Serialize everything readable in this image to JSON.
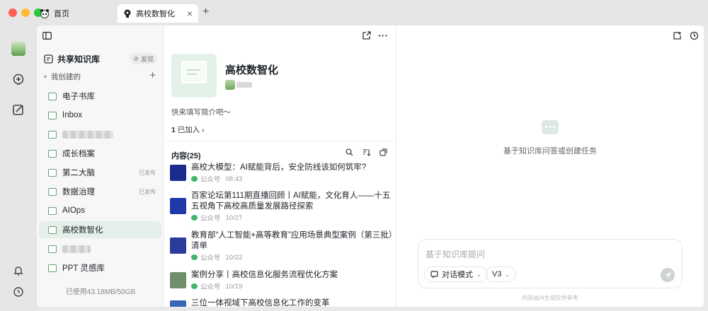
{
  "tabs": [
    {
      "label": "首页",
      "icon": "panda-icon"
    },
    {
      "label": "高校数智化",
      "icon": "bulb-icon",
      "active": true
    }
  ],
  "sidebar": {
    "shared_label": "共享知识库",
    "discover_label": "发现",
    "mine_label": "我创建的",
    "items": [
      {
        "label": "电子书库",
        "tag": ""
      },
      {
        "label": "Inbox",
        "tag": ""
      },
      {
        "label": "",
        "tag": "",
        "blurred": true
      },
      {
        "label": "成长档案",
        "tag": ""
      },
      {
        "label": "第二大脑",
        "tag": "已发布"
      },
      {
        "label": "数据治理",
        "tag": "已发布"
      },
      {
        "label": "AIOps",
        "tag": ""
      },
      {
        "label": "高校数智化",
        "tag": "",
        "active": true
      },
      {
        "label": "",
        "tag": "",
        "blurred": true
      },
      {
        "label": "PPT 灵感库",
        "tag": ""
      }
    ],
    "usage": "已使用43.18MB/50GB"
  },
  "kb": {
    "title": "高校数智化",
    "description": "快来填写简介吧～",
    "joined_count": "1",
    "joined_label": "已加入 ›",
    "content_header": "内容(25)"
  },
  "docs": [
    {
      "title": "高校大模型：AI赋能背后，安全防线该如何筑牢?",
      "source": "公众号",
      "date": "08:43",
      "thumb": "#1a2d8f"
    },
    {
      "title": "百家论坛第111期直播回顾丨AI赋能，文化育人——十五五视角下高校高质量发展路径探索",
      "source": "公众号",
      "date": "10/27",
      "thumb": "#1e3aa8"
    },
    {
      "title": "教育部“人工智能+高等教育”应用场景典型案例（第三批）清单",
      "source": "公众号",
      "date": "10/22",
      "thumb": "#2b3c9b"
    },
    {
      "title": "案例分享丨高校信息化服务流程优化方案",
      "source": "公众号",
      "date": "10/19",
      "thumb": "#6e8f6a"
    },
    {
      "title": "三位一体视域下高校信息化工作的变革",
      "source": "",
      "date": "",
      "thumb": "#3a66b8"
    }
  ],
  "chat": {
    "empty_text": "基于知识库问答或创建任务",
    "placeholder": "基于知识库提问",
    "mode_label": "对话模式",
    "version_label": "V3",
    "disclaimer": "内容由AI生成仅供参考"
  },
  "colors": {
    "accent": "#6a9f7c",
    "active_bg": "#e4efe9"
  }
}
